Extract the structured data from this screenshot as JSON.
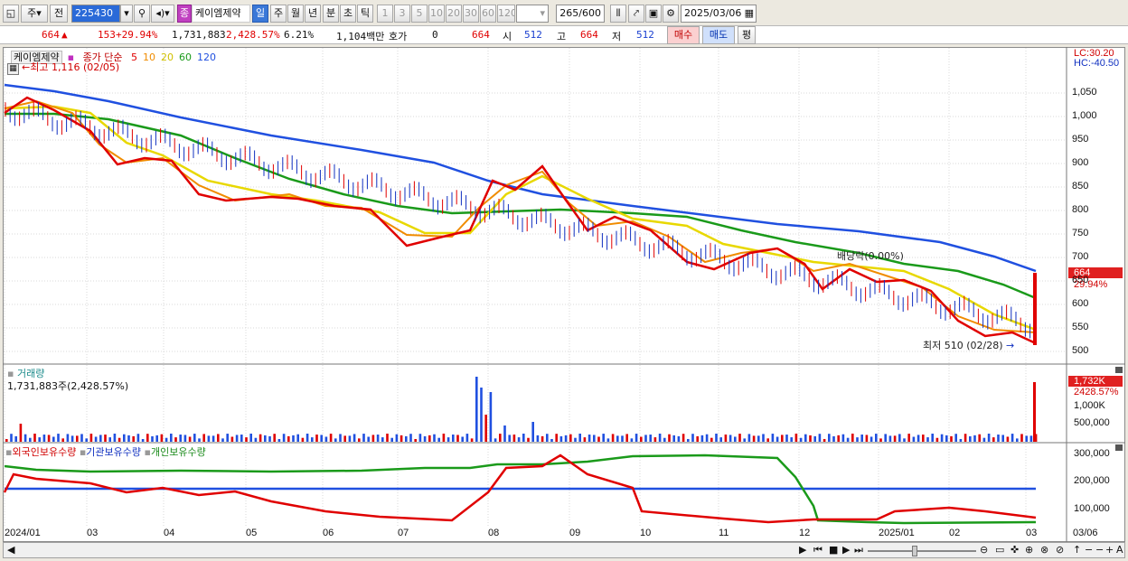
{
  "toolbar": {
    "market": "주",
    "prev": "전",
    "code": "225430",
    "badge": "종",
    "name": "케이엠제약",
    "periods": [
      "일",
      "주",
      "월",
      "년",
      "분",
      "초",
      "틱"
    ],
    "minutes": [
      "1",
      "3",
      "5",
      "10",
      "20",
      "30",
      "60",
      "120"
    ],
    "count": "265",
    "count_total": "/600",
    "date": "2025/03/06"
  },
  "quote": {
    "price": "664",
    "change": "153",
    "pct": "+29.94%",
    "volume": "1,731,883",
    "vol_pct": "2,428.57%",
    "turnover": "6.21%",
    "amount": "1,104백만",
    "ask_label": "호가",
    "ask_val": "0",
    "ask_price": "664",
    "open_label": "시",
    "open": "512",
    "high_label": "고",
    "high": "664",
    "low_label": "저",
    "low": "512",
    "buy": "매수",
    "sell": "매도",
    "eval": "평"
  },
  "price_panel": {
    "name": "케이엠제약",
    "legend_main": "종가 단순",
    "ma": [
      {
        "label": "5",
        "color": "#e00000"
      },
      {
        "label": "10",
        "color": "#f08c00"
      },
      {
        "label": "20",
        "color": "#e8d800"
      },
      {
        "label": "60",
        "color": "#1a9a1a"
      },
      {
        "label": "120",
        "color": "#2050e0"
      }
    ],
    "high_note": "최고 1,116 (02/05)",
    "low_note": "최저 510 (02/28)",
    "dividend_note": "배당락(0.00%)",
    "lc": "LC:30.20",
    "hc": "HC:-40.50",
    "last_price": "664",
    "last_pct": "29.94%",
    "y_ticks": [
      "1,050",
      "1,000",
      "950",
      "900",
      "850",
      "800",
      "750",
      "700",
      "650",
      "600",
      "550",
      "500"
    ]
  },
  "volume_panel": {
    "title": "거래량",
    "value": "1,731,883주(2,428.57%)",
    "last": "1,732K",
    "last_pct": "2428.57%",
    "y_ticks": [
      "1,000K",
      "500,000"
    ]
  },
  "holding_panel": {
    "series": [
      "외국인보유수량",
      "기관보유수량",
      "개인보유수량"
    ],
    "y_ticks": [
      "300,000",
      "200,000",
      "100,000"
    ]
  },
  "x_labels": [
    "2024/01",
    "03",
    "04",
    "05",
    "06",
    "07",
    "08",
    "09",
    "10",
    "11",
    "12",
    "2025/01",
    "02",
    "03",
    "03/06"
  ]
}
